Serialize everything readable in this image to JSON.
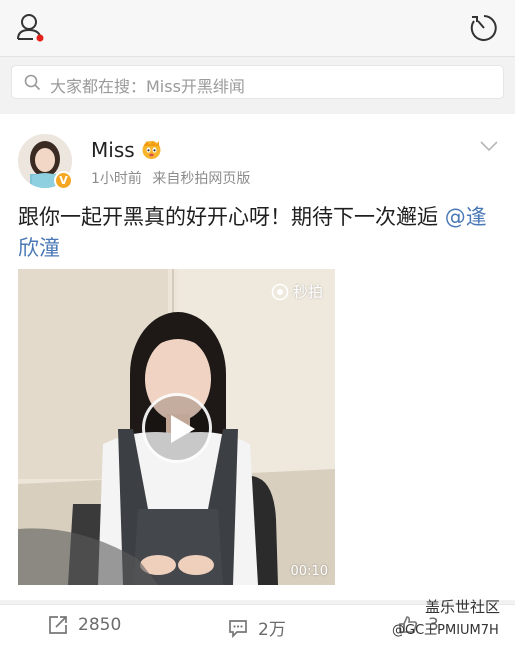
{
  "search": {
    "placeholder": "大家都在搜：Miss开黑绯闻"
  },
  "post": {
    "author": "Miss",
    "time": "1小时前",
    "source": "来自秒拍网页版",
    "text": "跟你一起开黑真的好开心呀！期待下一次邂逅 ",
    "mention": "@逢欣潼",
    "video": {
      "logo": "秒拍",
      "duration": "00:10"
    }
  },
  "actions": {
    "repost_count": "2850",
    "comment_count": "2万",
    "like_count": "3"
  },
  "watermark": {
    "title": "盖乐世社区",
    "user": "@GC王PMIUM7H"
  },
  "colors": {
    "mention": "#4a79b6",
    "verified_badge": "#f5a623",
    "notification_dot": "#e2231a"
  },
  "icons": {
    "top_left": "user-icon",
    "top_right": "radar-icon",
    "search": "search-icon",
    "repost": "repost-icon",
    "comment": "comment-icon",
    "like": "like-icon"
  }
}
